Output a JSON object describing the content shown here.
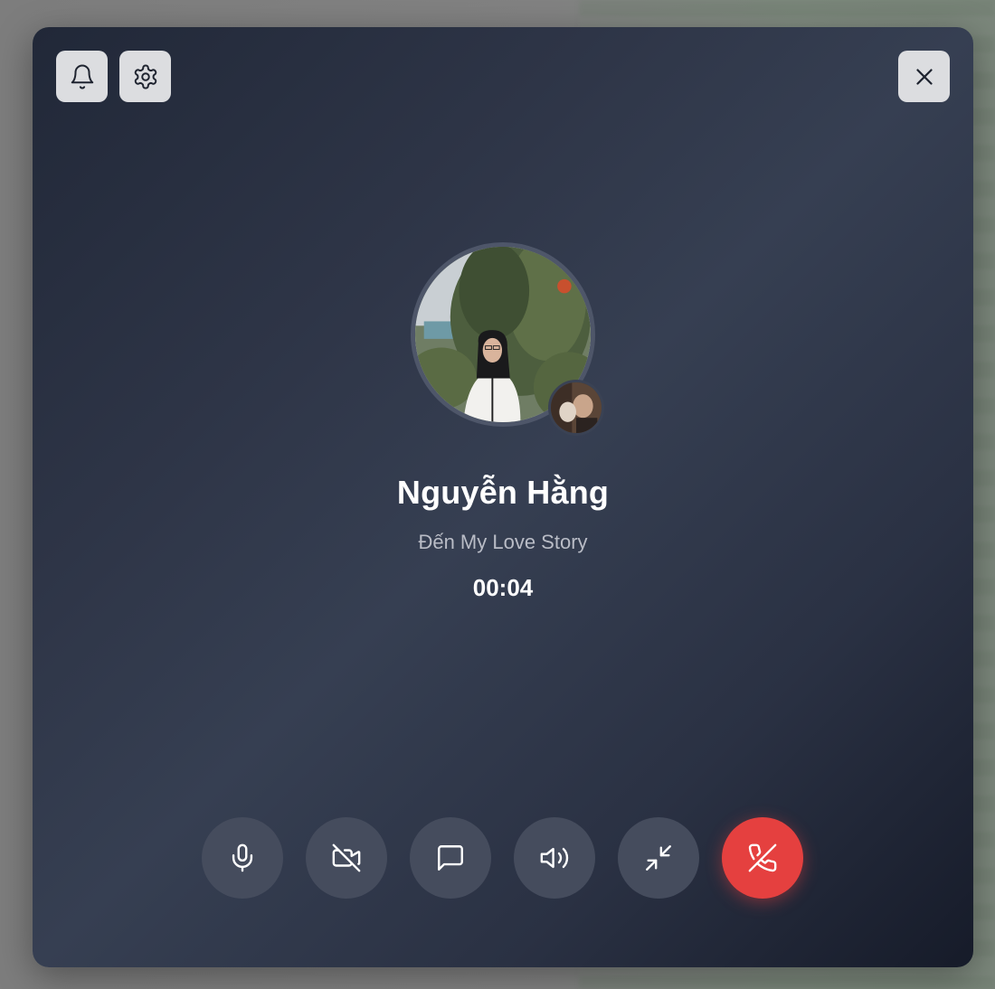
{
  "window": {
    "title": ""
  },
  "top_bar": {
    "left_buttons": [
      {
        "icon": "bell-icon",
        "name": "notifications-button"
      },
      {
        "icon": "gear-icon",
        "name": "settings-button"
      }
    ],
    "close_button": {
      "icon": "close-icon"
    }
  },
  "caller": {
    "name": "Nguyễn Hằng",
    "subtitle": "Đến My Love Story",
    "timer": "00:04"
  },
  "controls": [
    {
      "name": "mute-button",
      "icon": "microphone-icon"
    },
    {
      "name": "video-toggle-button",
      "icon": "video-off-icon"
    },
    {
      "name": "chat-button",
      "icon": "message-icon"
    },
    {
      "name": "speaker-button",
      "icon": "speaker-icon"
    },
    {
      "name": "minimize-button",
      "icon": "minimize-icon"
    },
    {
      "name": "hang-up-button",
      "icon": "phone-off-icon"
    }
  ],
  "colors": {
    "hangup": "#e5403f",
    "control_bg": "#454c5d",
    "top_button_bg": "#dcdde0"
  }
}
